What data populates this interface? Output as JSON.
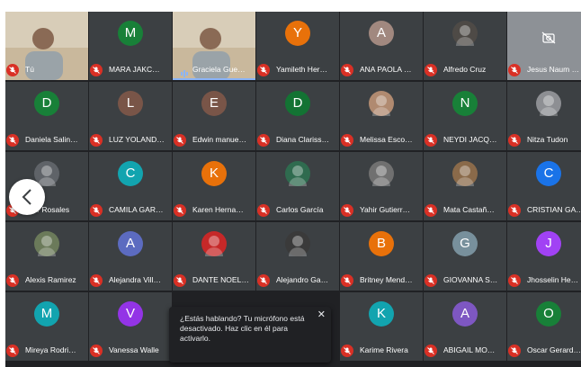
{
  "meeting": {
    "participants": [
      {
        "name": "Tú",
        "avatar": "",
        "tile": "video",
        "mic": "muted"
      },
      {
        "name": "MARA JAKC…",
        "avatar": "M",
        "tile": "avatar",
        "color": "#188038",
        "mic": "muted"
      },
      {
        "name": "Graciela Gue…",
        "avatar": "",
        "tile": "video",
        "mic": "speaking"
      },
      {
        "name": "Yamileth Her…",
        "avatar": "Y",
        "tile": "avatar",
        "color": "#e8710a",
        "mic": "muted"
      },
      {
        "name": "ANA PAOLA …",
        "avatar": "A",
        "tile": "avatar",
        "color": "#a1887f",
        "mic": "muted"
      },
      {
        "name": "Alfredo Cruz",
        "avatar": "",
        "tile": "photo",
        "color": "#4e4a46",
        "mic": "muted"
      },
      {
        "name": "Jesus Naum …",
        "avatar": "",
        "tile": "camera-off",
        "mic": "muted"
      },
      {
        "name": "Daniela Salin…",
        "avatar": "D",
        "tile": "avatar",
        "color": "#188038",
        "mic": "muted"
      },
      {
        "name": "LUZ YOLAND…",
        "avatar": "L",
        "tile": "avatar",
        "color": "#795548",
        "mic": "muted"
      },
      {
        "name": "Edwin manue…",
        "avatar": "E",
        "tile": "avatar",
        "color": "#795548",
        "mic": "muted"
      },
      {
        "name": "Diana Clariss…",
        "avatar": "D",
        "tile": "avatar",
        "color": "#137333",
        "mic": "muted"
      },
      {
        "name": "Melissa Esco…",
        "avatar": "",
        "tile": "photo",
        "color": "#b08a70",
        "mic": "muted"
      },
      {
        "name": "NEYDI JACQ…",
        "avatar": "N",
        "tile": "avatar",
        "color": "#188038",
        "mic": "muted"
      },
      {
        "name": "Nitza Tudon",
        "avatar": "",
        "tile": "photo",
        "color": "#8d8f93",
        "mic": "muted"
      },
      {
        "name": "…er Rosales",
        "avatar": "",
        "tile": "photo",
        "color": "#5f6368",
        "mic": "muted"
      },
      {
        "name": "CAMILA GAR…",
        "avatar": "C",
        "tile": "avatar",
        "color": "#12a4af",
        "mic": "muted"
      },
      {
        "name": "Karen Herna…",
        "avatar": "K",
        "tile": "avatar",
        "color": "#e8710a",
        "mic": "muted"
      },
      {
        "name": "Carlos García",
        "avatar": "",
        "tile": "photo",
        "color": "#2f6b4f",
        "mic": "muted"
      },
      {
        "name": "Yahir Gutierr…",
        "avatar": "",
        "tile": "photo",
        "color": "#707070",
        "mic": "muted"
      },
      {
        "name": "Mata Castañ…",
        "avatar": "",
        "tile": "photo",
        "color": "#8a6a4a",
        "mic": "muted"
      },
      {
        "name": "CRISTIAN GA…",
        "avatar": "C",
        "tile": "avatar",
        "color": "#1a73e8",
        "mic": "muted"
      },
      {
        "name": "Alexis Ramirez",
        "avatar": "",
        "tile": "photo",
        "color": "#6b7a5a",
        "mic": "muted"
      },
      {
        "name": "Alejandra Vill…",
        "avatar": "A",
        "tile": "avatar",
        "color": "#5c6bc0",
        "mic": "muted"
      },
      {
        "name": "DANTE NOEL…",
        "avatar": "",
        "tile": "photo",
        "color": "#c62828",
        "mic": "muted"
      },
      {
        "name": "Alejandro Ga…",
        "avatar": "",
        "tile": "photo",
        "color": "#3a3a3a",
        "mic": "muted"
      },
      {
        "name": "Britney Mend…",
        "avatar": "B",
        "tile": "avatar",
        "color": "#e8710a",
        "mic": "muted"
      },
      {
        "name": "GIOVANNA S…",
        "avatar": "G",
        "tile": "avatar",
        "color": "#78909c",
        "mic": "muted"
      },
      {
        "name": "Jhosselin He…",
        "avatar": "J",
        "tile": "avatar",
        "color": "#a142f4",
        "mic": "muted"
      },
      {
        "name": "Mireya Rodri…",
        "avatar": "M",
        "tile": "avatar",
        "color": "#12a4af",
        "mic": "muted"
      },
      {
        "name": "Vanessa Walle",
        "avatar": "V",
        "tile": "avatar",
        "color": "#9334e6",
        "mic": "muted"
      },
      {
        "name": "",
        "avatar": "",
        "tile": "hidden",
        "mic": "none"
      },
      {
        "name": "",
        "avatar": "",
        "tile": "hidden",
        "mic": "none"
      },
      {
        "name": "Karime Rivera",
        "avatar": "K",
        "tile": "avatar",
        "color": "#12a4af",
        "mic": "muted"
      },
      {
        "name": "ABIGAIL MO…",
        "avatar": "A",
        "tile": "avatar",
        "color": "#7e57c2",
        "mic": "muted"
      },
      {
        "name": "Oscar Gerard…",
        "avatar": "O",
        "tile": "avatar",
        "color": "#188038",
        "mic": "muted"
      }
    ]
  },
  "icons": {
    "mic_muted": "mic-off-icon",
    "camera_off": "camera-off-icon",
    "speaking": "audio-level-icon",
    "prev": "chevron-left-icon",
    "close": "close-icon"
  },
  "toast": {
    "text": "¿Estás hablando? Tu micrófono está desactivado. Haz clic en él para activarlo.",
    "close_label": "✕"
  },
  "colors": {
    "background": "#202124",
    "tile": "#3c4043",
    "muted": "#d93025",
    "speaking": "#8ab4f8"
  }
}
